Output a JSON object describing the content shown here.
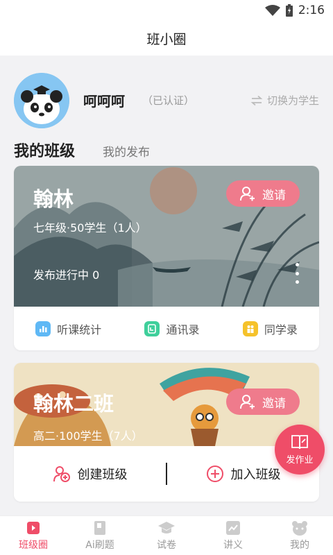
{
  "status_bar": {
    "time": "2:16"
  },
  "header": {
    "title": "班小圈"
  },
  "profile": {
    "name": "呵呵呵",
    "verified": "（已认证）",
    "switch_label": "切换为学生"
  },
  "tabs": [
    {
      "label": "我的班级",
      "active": true
    },
    {
      "label": "我的发布",
      "active": false
    }
  ],
  "classes": [
    {
      "name": "翰林",
      "info": "七年级·50学生（1人）",
      "progress": "发布进行中  0",
      "invite_label": "邀请",
      "actions": [
        {
          "label": "听课统计",
          "icon": "chart-icon",
          "color": "#5fb8f5"
        },
        {
          "label": "通讯录",
          "icon": "contacts-icon",
          "color": "#3fcf9b"
        },
        {
          "label": "同学录",
          "icon": "classmates-icon",
          "color": "#f5c22b"
        }
      ]
    },
    {
      "name": "翰林二班",
      "info": "高二·100学生（7人）",
      "invite_label": "邀请"
    }
  ],
  "bottom_actions": {
    "create": "创建班级",
    "join": "加入班级"
  },
  "fab": {
    "label": "发作业"
  },
  "nav": [
    {
      "label": "班级圈",
      "icon": "class-circle-icon",
      "active": true
    },
    {
      "label": "Ai刷题",
      "icon": "book-icon",
      "active": false
    },
    {
      "label": "试卷",
      "icon": "graduation-cap-icon",
      "active": false
    },
    {
      "label": "讲义",
      "icon": "trend-icon",
      "active": false
    },
    {
      "label": "我的",
      "icon": "bear-icon",
      "active": false
    }
  ],
  "colors": {
    "accent": "#ef4d68",
    "invite": "#ef7b8c",
    "muted": "#999999"
  }
}
